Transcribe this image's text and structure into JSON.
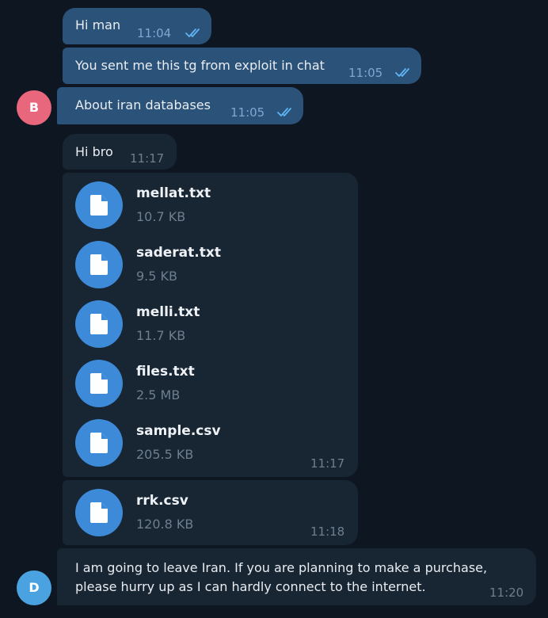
{
  "messages": {
    "m1": {
      "text": "Hi man",
      "time": "11:04"
    },
    "m2": {
      "text": "You sent me this tg from exploit in chat",
      "time": "11:05"
    },
    "m3": {
      "text": "About iran databases",
      "time": "11:05"
    },
    "m4": {
      "text": "Hi bro",
      "time": "11:17"
    },
    "files_group": {
      "time": "11:17",
      "files": [
        {
          "name": "mellat.txt",
          "size": "10.7 KB"
        },
        {
          "name": "saderat.txt",
          "size": "9.5 KB"
        },
        {
          "name": "melli.txt",
          "size": "11.7 KB"
        },
        {
          "name": "files.txt",
          "size": "2.5 MB"
        },
        {
          "name": "sample.csv",
          "size": "205.5 KB"
        }
      ]
    },
    "file_single": {
      "time": "11:18",
      "name": "rrk.csv",
      "size": "120.8 KB"
    },
    "m5": {
      "line1": "I am going to leave Iran. If you are planning to make a purchase,",
      "line2": "please hurry up as I can hardly connect to the internet.",
      "time": "11:20"
    }
  },
  "avatars": {
    "b": {
      "letter": "B",
      "color": "#e8677d"
    },
    "d": {
      "letter": "D",
      "color": "#4aa3e0"
    }
  },
  "colors": {
    "background": "#0e1621",
    "outgoing_bubble": "#2b5278",
    "incoming_bubble": "#182533",
    "file_icon": "#3d8bd8",
    "read_checks": "#5fb4f4"
  },
  "icons": {
    "read_status": "double-check-icon",
    "file": "document-icon"
  }
}
